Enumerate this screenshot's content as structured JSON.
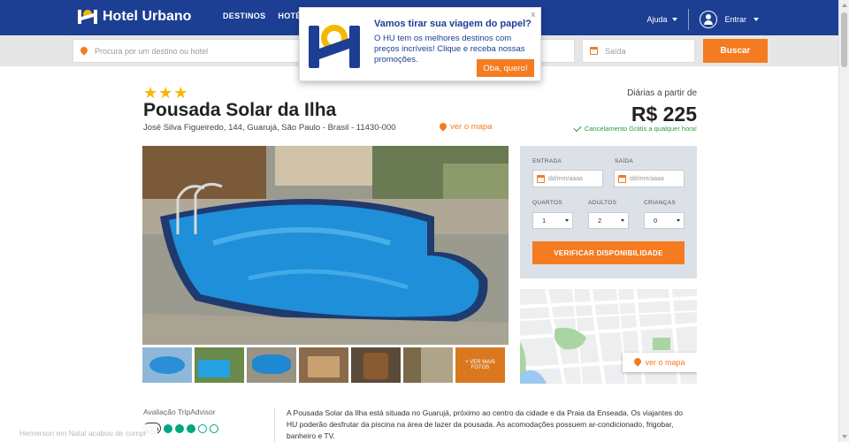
{
  "header": {
    "brand": "Hotel Urbano",
    "nav": [
      "DESTINOS",
      "HOTÉ"
    ],
    "help": "Ajuda",
    "login": "Entrar"
  },
  "search": {
    "destination_placeholder": "Procura por um destino ou hotel",
    "checkout_placeholder": "Saída",
    "button": "Buscar"
  },
  "popup": {
    "title": "Vamos tirar sua viagem do papel?",
    "body": "O HU tem os melhores destinos com preços incríveis! Clique e receba nossas promoções.",
    "cta": "Oba, quero!",
    "close": "x"
  },
  "hotel": {
    "stars": "★★★",
    "star_rating": 3,
    "name": "Pousada Solar da Ilha",
    "address": "José Silva Figueiredo, 144, Guarujá, São Paulo - Brasil - 11430-000",
    "map_link": "ver o mapa",
    "price_label": "Diárias a partir de",
    "price": "R$ 225",
    "cancellation": "Cancelamento Grátis a qualquer hora!"
  },
  "gallery": {
    "more_label": "+ VER MAIS FOTOS"
  },
  "booking": {
    "checkin_label": "ENTRADA",
    "checkout_label": "SAÍDA",
    "date_placeholder": "dd/mm/aaaa",
    "rooms_label": "QUARTOS",
    "adults_label": "ADULTOS",
    "children_label": "CRIANÇAS",
    "rooms_value": "1",
    "adults_value": "2",
    "children_value": "0",
    "button": "VERIFICAR DISPONIBILIDADE"
  },
  "map": {
    "link": "ver o mapa"
  },
  "tripadvisor": {
    "label": "Avaliação TripAdvisor",
    "rating": 3
  },
  "description": "A Pousada Solar da Ilha está situada no Guarujá, próximo ao centro da cidade e da Praia da Enseada. Os viajantes do HU poderão desfrutar da piscina na área de lazer da pousada. As acomodações possuem ar-condicionado, frigobar, banheiro e TV.",
  "toast": "Hemerson em Natal acabou de compr",
  "colors": {
    "brand_blue": "#1c3f94",
    "accent_orange": "#f47b20",
    "success_green": "#2a9d3c",
    "tripadvisor_green": "#00a680"
  }
}
